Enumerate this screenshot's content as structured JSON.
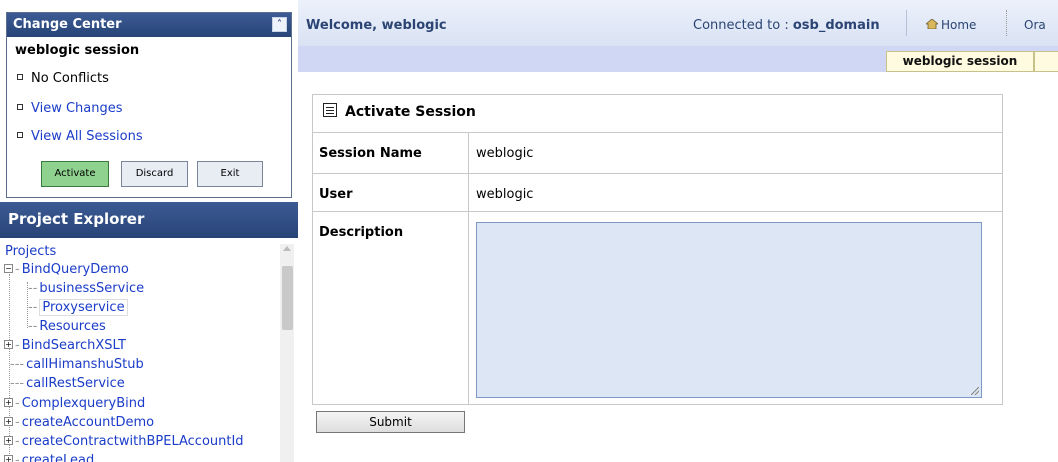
{
  "change_center": {
    "title": "Change Center",
    "session": "weblogic session",
    "items": [
      {
        "label": "No Conflicts"
      },
      {
        "label": "View Changes"
      },
      {
        "label": "View All Sessions"
      }
    ],
    "buttons": {
      "activate": "Activate",
      "discard": "Discard",
      "exit": "Exit"
    },
    "colors": {
      "header": "#2f4d84",
      "activate": "#8fd18f"
    }
  },
  "project_explorer": {
    "title": "Project Explorer",
    "root": "Projects",
    "tree": [
      {
        "label": "BindQueryDemo"
      },
      {
        "label": "businessService"
      },
      {
        "label": "Proxyservice"
      },
      {
        "label": "Resources"
      },
      {
        "label": "BindSearchXSLT"
      },
      {
        "label": "callHimanshuStub"
      },
      {
        "label": "callRestService"
      },
      {
        "label": "ComplexqueryBind"
      },
      {
        "label": "createAccountDemo"
      },
      {
        "label": "createContractwithBPELAccountId"
      },
      {
        "label": "createLead"
      }
    ]
  },
  "header": {
    "welcome": "Welcome, weblogic",
    "connected_label": "Connected to :",
    "domain": "osb_domain",
    "home": "Home",
    "ora": "Ora",
    "session_tab": "weblogic session"
  },
  "form": {
    "title": "Activate Session",
    "session_name_label": "Session Name",
    "session_name_value": "weblogic",
    "user_label": "User",
    "user_value": "weblogic",
    "description_label": "Description",
    "description_value": "",
    "submit": "Submit"
  }
}
